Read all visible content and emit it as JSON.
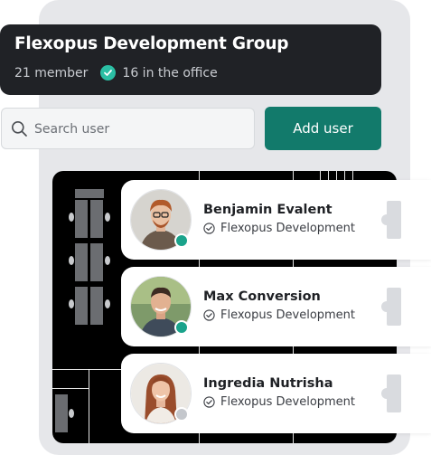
{
  "colors": {
    "accent": "#127a6b",
    "online": "#1aa38b",
    "offline": "#c4c7cc",
    "header_bg": "#202226",
    "check_badge": "#2bbfa4"
  },
  "header": {
    "title": "Flexopus Development Group",
    "member_count": "21 member",
    "office_status": "16 in the office",
    "office_icon": "check-circle-icon"
  },
  "search": {
    "placeholder": "Search user",
    "icon": "search-icon"
  },
  "add_user_label": "Add user",
  "users": [
    {
      "name": "Benjamin Evalent",
      "team": "Flexopus Development",
      "status": "online"
    },
    {
      "name": "Max Conversion",
      "team": "Flexopus Development",
      "status": "online"
    },
    {
      "name": "Ingredia Nutrisha",
      "team": "Flexopus Development",
      "status": "offline"
    }
  ]
}
